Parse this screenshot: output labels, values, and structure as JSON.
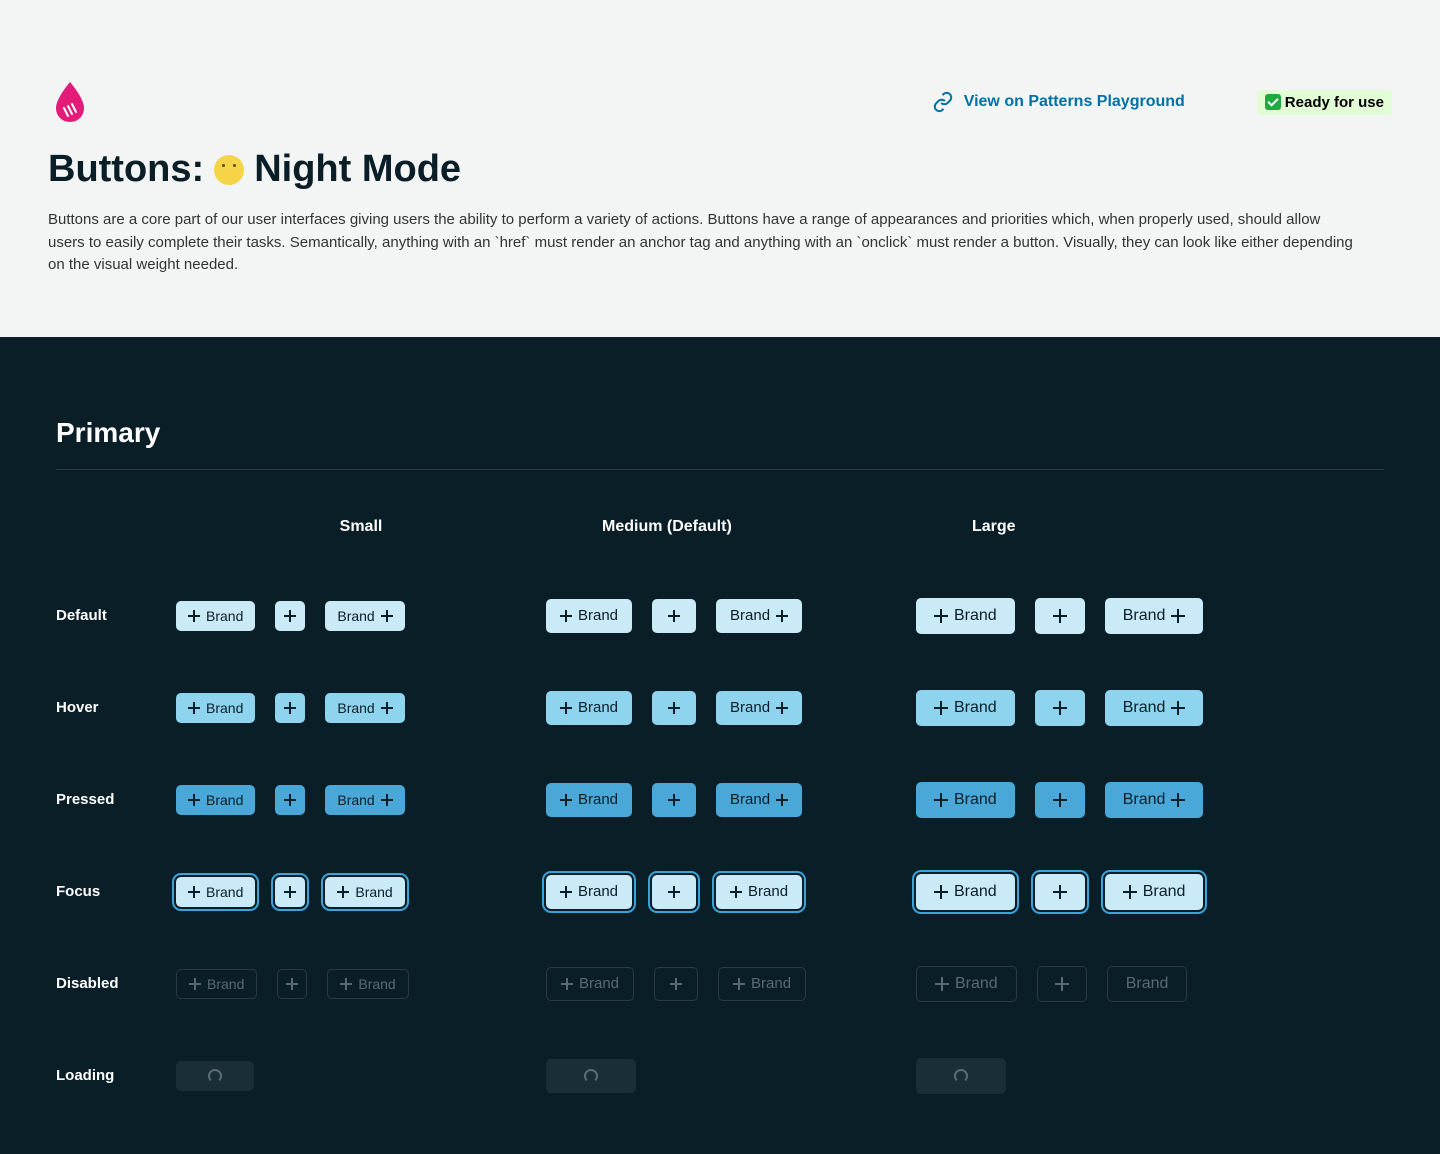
{
  "header": {
    "playground_link": "View on Patterns Playground",
    "ready_badge": "Ready for use",
    "title_prefix": "Buttons:",
    "title_suffix": "Night Mode",
    "description": "Buttons are a core part of our user interfaces giving users the ability to perform a variety of actions. Buttons have a range of appearances and priorities which, when properly used, should allow users to easily complete their tasks. Semantically, anything with an `href` must render an anchor tag and anything with an `onclick` must render a button. Visually, they can look like either depending on the visual weight needed."
  },
  "section": {
    "title": "Primary"
  },
  "columns": {
    "small": "Small",
    "medium": "Medium (Default)",
    "large": "Large"
  },
  "rows": {
    "default": "Default",
    "hover": "Hover",
    "pressed": "Pressed",
    "focus": "Focus",
    "disabled": "Disabled",
    "loading": "Loading"
  },
  "button_label": "Brand",
  "colors": {
    "brand_logo": "#e31c79",
    "link_accent": "#0071a4",
    "ready_bg": "#e2fcd6",
    "dark_bg": "#0a1e28",
    "btn_default": "#cbeaf8",
    "btn_hover": "#8fd4ee",
    "btn_pressed": "#4aa8d8"
  }
}
